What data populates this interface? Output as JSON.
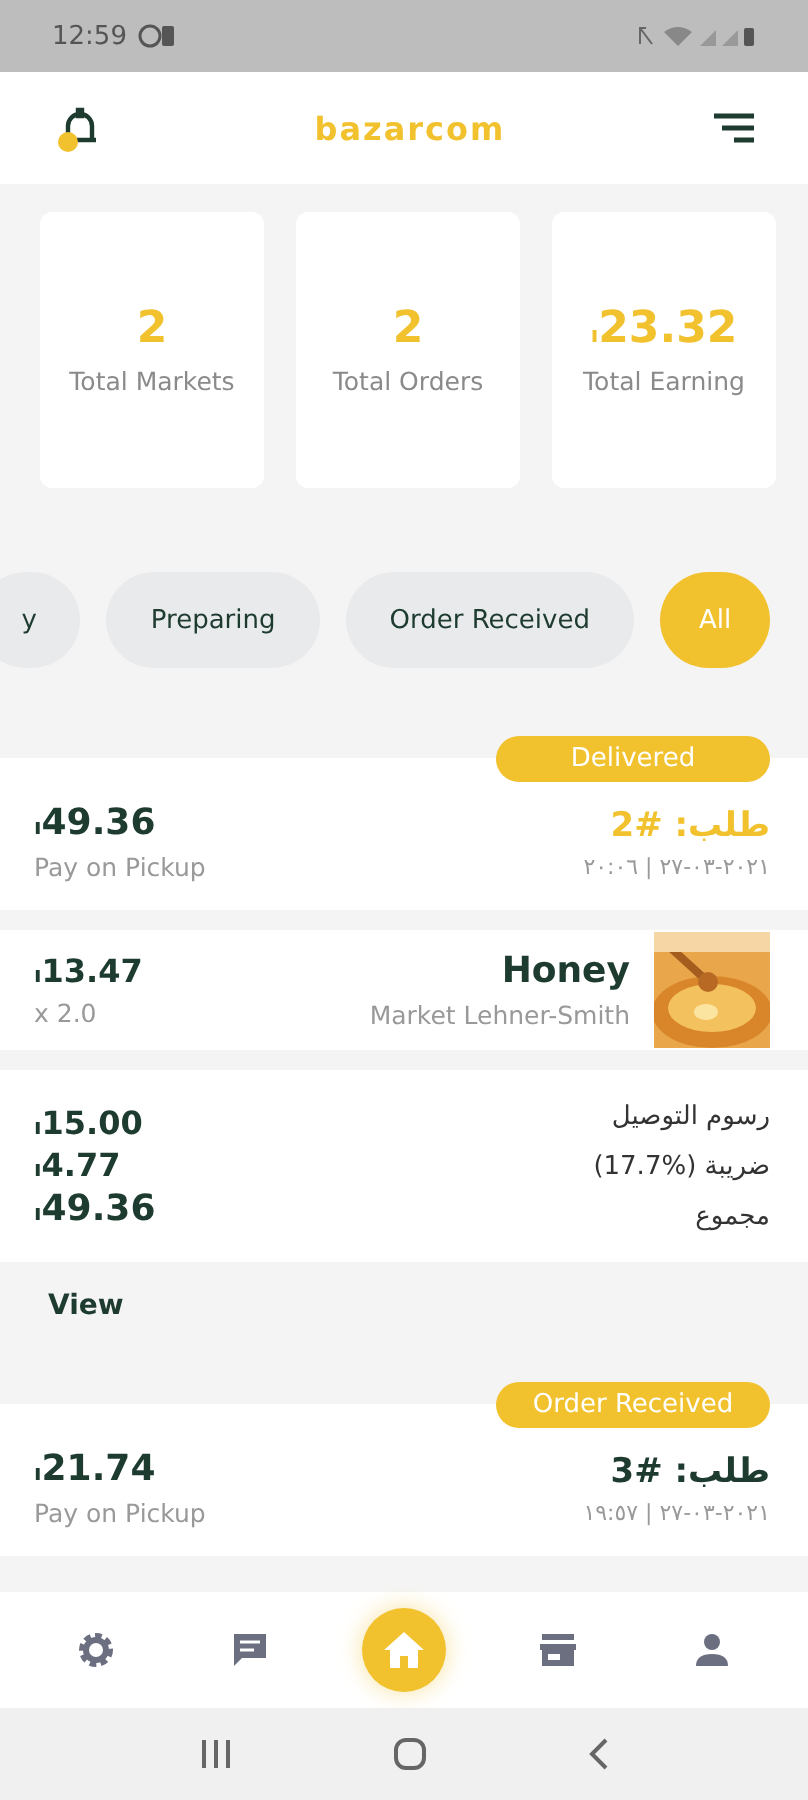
{
  "status_bar": {
    "time": "12:59"
  },
  "header": {
    "title": "bazarcom"
  },
  "stats": [
    {
      "value": "2",
      "label": "Total Markets"
    },
    {
      "value": "2",
      "label": "Total Orders"
    },
    {
      "value": "23.32",
      "currency": "ı",
      "label": "Total Earning"
    }
  ],
  "filters": [
    {
      "label": "y",
      "selected": false
    },
    {
      "label": "Preparing",
      "selected": false
    },
    {
      "label": "Order Received",
      "selected": false
    },
    {
      "label": "All",
      "selected": true
    }
  ],
  "orders": [
    {
      "status": "Delivered",
      "title": "طلب: #2",
      "highlighted": true,
      "date": "٢٠٢١-٠٣-٢٧ | ٢٠:٠٦",
      "currency": "ı",
      "total": "49.36",
      "payment": "Pay on Pickup",
      "items": [
        {
          "name": "Honey",
          "market": "Market Lehner-Smith",
          "currency": "ı",
          "price": "13.47",
          "quantity": "x 2.0"
        }
      ],
      "summary": [
        {
          "label": "رسوم التوصيل",
          "currency": "ı",
          "value": "15.00"
        },
        {
          "label": "ضريبة (%17.7)",
          "currency": "ı",
          "value": "4.77"
        },
        {
          "label": "مجموع",
          "currency": "ı",
          "value": "49.36"
        }
      ],
      "action": "View"
    },
    {
      "status": "Order Received",
      "title": "طلب: #3",
      "highlighted": false,
      "date": "٢٠٢١-٠٣-٢٧ | ١٩:٥٧",
      "currency": "ı",
      "total": "21.74",
      "payment": "Pay on Pickup"
    }
  ],
  "bottom_nav": [
    {
      "kind": "settings",
      "selected": false
    },
    {
      "kind": "chat",
      "selected": false
    },
    {
      "kind": "home",
      "selected": true
    },
    {
      "kind": "store",
      "selected": false
    },
    {
      "kind": "person",
      "selected": false
    }
  ]
}
